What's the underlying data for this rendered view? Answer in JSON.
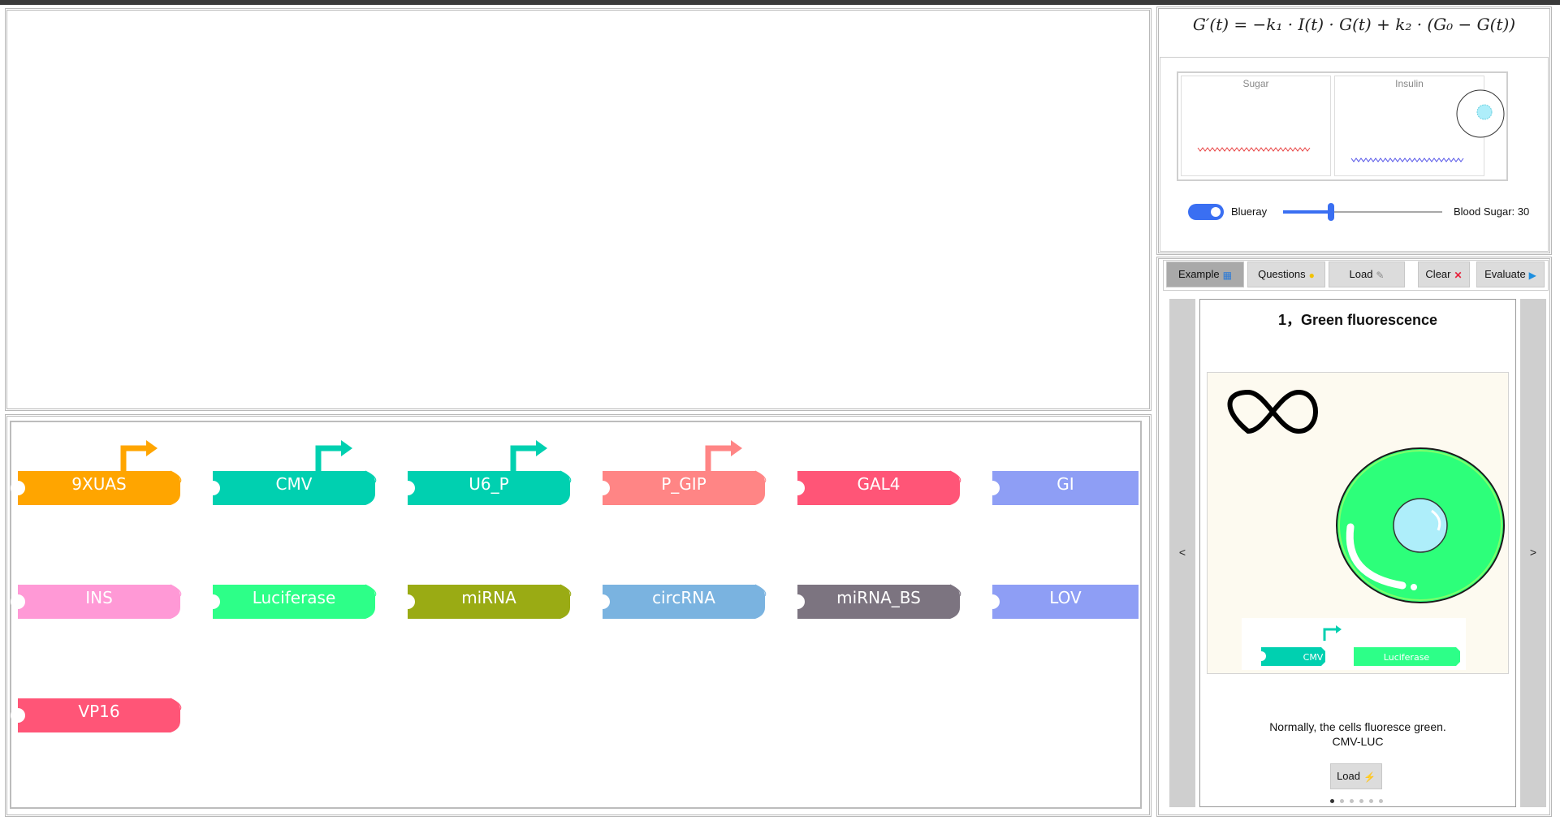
{
  "formula": "G′(t) = −k₁ · I(t) · G(t) + k₂ · (G₀ − G(t))",
  "simulation": {
    "sugar_title": "Sugar",
    "insulin_title": "Insulin",
    "toggle_label": "Blueray",
    "toggle_on": true,
    "blood_sugar_label": "Blood Sugar: 30",
    "blood_sugar_value": 30,
    "slider_fraction": 0.3
  },
  "toolbar": {
    "example": "Example",
    "questions": "Questions",
    "load": "Load",
    "clear": "Clear",
    "evaluate": "Evaluate"
  },
  "parts": [
    {
      "label": "9XUAS",
      "color": "#ffa500",
      "promoter": true
    },
    {
      "label": "CMV",
      "color": "#00d0b0",
      "promoter": true
    },
    {
      "label": "U6_P",
      "color": "#00d0b0",
      "promoter": true
    },
    {
      "label": "P_GIP",
      "color": "#ff8585",
      "promoter": true
    },
    {
      "label": "GAL4",
      "color": "#ff5577",
      "promoter": false
    },
    {
      "label": "GI",
      "color": "#8e9ef5",
      "promoter": false
    },
    {
      "label": "INS",
      "color": "#ff99d6",
      "promoter": false
    },
    {
      "label": "Luciferase",
      "color": "#2dff88",
      "promoter": false
    },
    {
      "label": "miRNA",
      "color": "#9aab14",
      "promoter": false
    },
    {
      "label": "circRNA",
      "color": "#7ab3e0",
      "promoter": false
    },
    {
      "label": "miRNA_BS",
      "color": "#7c7480",
      "promoter": false
    },
    {
      "label": "LOV",
      "color": "#8e9ef5",
      "promoter": false
    },
    {
      "label": "VP16",
      "color": "#ff5577",
      "promoter": false
    }
  ],
  "carousel": {
    "title": "1，Green fluorescence",
    "description_line1": "Normally, the cells fluoresce green.",
    "description_line2": "CMV-LUC",
    "load_button": "Load",
    "prev": "<",
    "next": ">",
    "page_count": 6,
    "current_page": 1,
    "mini_parts": [
      "CMV",
      "Luciferase"
    ]
  }
}
